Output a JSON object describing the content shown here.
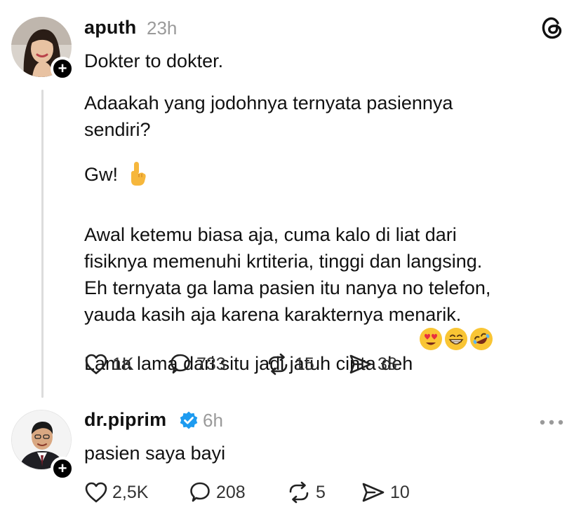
{
  "post1": {
    "username": "aputh",
    "time": "23h",
    "paragraphs": [
      "Dokter to dokter.",
      "Adaakah yang jodohnya ternyata pasiennya\nsendiri?",
      "Gw!"
    ],
    "body": "Awal ketemu biasa aja, cuma kalo di liat dari\nfisiknya memenuhi krtiteria, tinggi dan langsing.\nEh ternyata ga lama pasien itu nanya no telefon,\nyauda kasih aja karena karakternya menarik.\nLama lama dari situ jadi jatuh cinta deh",
    "likes": "1K",
    "replies": "733",
    "reposts": "15",
    "shares": "38",
    "icons": [
      "threads-logo-icon",
      "pointing-up-hand-emoji",
      "heart-eyes-emoji",
      "grinning-emoji",
      "rofl-emoji"
    ]
  },
  "post2": {
    "username": "dr.piprim",
    "time": "6h",
    "body": "pasien saya bayi",
    "likes": "2,5K",
    "replies": "208",
    "reposts": "5",
    "shares": "10",
    "icons": [
      "verified-badge-icon",
      "more-dots-icon"
    ]
  },
  "colors": {
    "verified": "#1D9BF0",
    "muted": "#9a9a9a",
    "threadLine": "#dcdcdc"
  }
}
